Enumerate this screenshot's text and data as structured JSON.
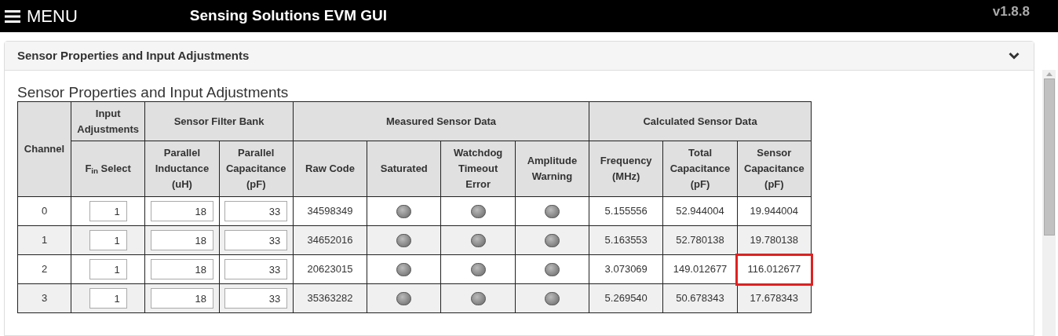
{
  "app_bar": {
    "menu_label": "MENU",
    "title": "Sensing Solutions EVM GUI",
    "version": "v1.8.8"
  },
  "panel": {
    "title": "Sensor Properties and Input Adjustments",
    "expanded": true,
    "heading": "Sensor Properties and Input Adjustments"
  },
  "table": {
    "channel_header": "Channel",
    "groups": [
      {
        "label": "Input Adjustments",
        "columns": [
          {
            "label": "F$_{in}$ Select",
            "kind": "input"
          }
        ]
      },
      {
        "label": "Sensor Filter Bank",
        "columns": [
          {
            "label": "Parallel Inductance (uH)",
            "kind": "input"
          },
          {
            "label": "Parallel Capacitance (pF)",
            "kind": "input"
          }
        ]
      },
      {
        "label": "Measured Sensor Data",
        "columns": [
          {
            "label": "Raw Code",
            "kind": "text"
          },
          {
            "label": "Saturated",
            "kind": "led"
          },
          {
            "label": "Watchdog Timeout Error",
            "kind": "led"
          },
          {
            "label": "Amplitude Warning",
            "kind": "led"
          }
        ]
      },
      {
        "label": "Calculated Sensor Data",
        "columns": [
          {
            "label": "Frequency (MHz)",
            "kind": "text"
          },
          {
            "label": "Total Capacitance (pF)",
            "kind": "text"
          },
          {
            "label": "Sensor Capacitance (pF)",
            "kind": "text"
          }
        ]
      }
    ],
    "rows": [
      {
        "channel": "0",
        "cells": [
          {
            "value": "1"
          },
          {
            "value": "18"
          },
          {
            "value": "33"
          },
          {
            "text": "34598349"
          },
          {
            "on": false
          },
          {
            "on": false
          },
          {
            "on": false
          },
          {
            "text": "5.155556"
          },
          {
            "text": "52.944004"
          },
          {
            "text": "19.944004",
            "highlighted": false
          }
        ]
      },
      {
        "channel": "1",
        "cells": [
          {
            "value": "1"
          },
          {
            "value": "18"
          },
          {
            "value": "33"
          },
          {
            "text": "34652016"
          },
          {
            "on": false
          },
          {
            "on": false
          },
          {
            "on": false
          },
          {
            "text": "5.163553"
          },
          {
            "text": "52.780138"
          },
          {
            "text": "19.780138",
            "highlighted": false
          }
        ]
      },
      {
        "channel": "2",
        "cells": [
          {
            "value": "1"
          },
          {
            "value": "18"
          },
          {
            "value": "33"
          },
          {
            "text": "20623015"
          },
          {
            "on": false
          },
          {
            "on": false
          },
          {
            "on": false
          },
          {
            "text": "3.073069"
          },
          {
            "text": "149.012677"
          },
          {
            "text": "116.012677",
            "highlighted": true
          }
        ]
      },
      {
        "channel": "3",
        "cells": [
          {
            "value": "1"
          },
          {
            "value": "18"
          },
          {
            "value": "33"
          },
          {
            "text": "35363282"
          },
          {
            "on": false
          },
          {
            "on": false
          },
          {
            "on": false
          },
          {
            "text": "5.269540"
          },
          {
            "text": "50.678343"
          },
          {
            "text": "17.678343",
            "highlighted": false
          }
        ]
      }
    ]
  }
}
